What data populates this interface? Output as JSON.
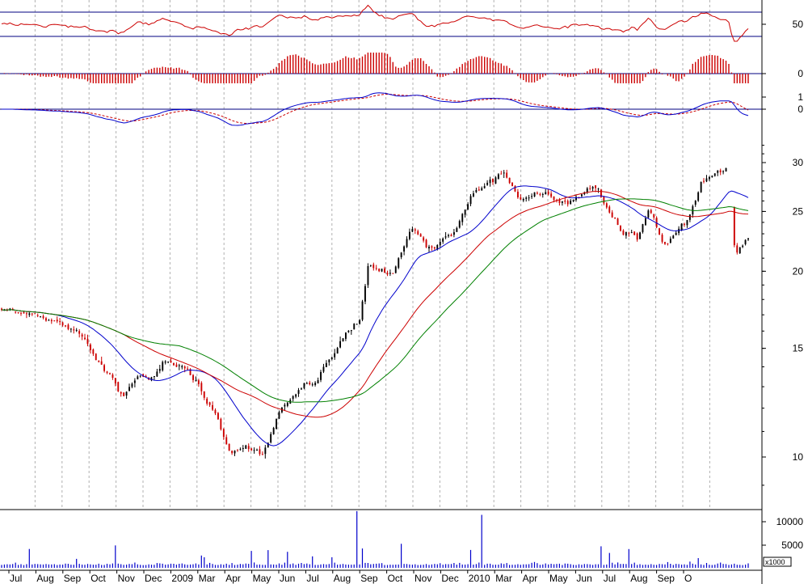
{
  "chart_data": {
    "type": "candlestick",
    "scale": "log",
    "grid": true,
    "colors": {
      "background": "#ffffff",
      "frame": "#000000",
      "grid": "#b0b0b0",
      "up_candle": "#000000",
      "down_candle": "#cc0000",
      "ma_short": "#0000cc",
      "ma_medium": "#cc0000",
      "ma_long": "#008000",
      "rsi_line": "#cc0000",
      "panel_ref_line": "#000080",
      "histogram": "#cc0000",
      "macd_line": "#0000cc",
      "macd_signal": "#cc0000",
      "volume": "#0000cc"
    },
    "x_axis": {
      "labels": [
        "Jul",
        "Aug",
        "Sep",
        "Oct",
        "Nov",
        "Dec",
        "2009",
        "Mar",
        "Apr",
        "May",
        "Jun",
        "Jul",
        "Aug",
        "Sep",
        "Oct",
        "Nov",
        "Dec",
        "2010",
        "Mar",
        "Apr",
        "May",
        "Jun",
        "Jul",
        "Aug",
        "Sep",
        "O"
      ]
    },
    "price_panel": {
      "y_ticks": [
        10,
        15,
        20,
        25,
        30
      ],
      "ylim": [
        8.5,
        33
      ],
      "anchors": [
        {
          "t": 0,
          "v": 17.3
        },
        {
          "t": 2.5,
          "v": 17.0
        },
        {
          "t": 4,
          "v": 16.4
        },
        {
          "t": 5.5,
          "v": 15.6
        },
        {
          "t": 7,
          "v": 13.8
        },
        {
          "t": 8.2,
          "v": 12.5
        },
        {
          "t": 9.2,
          "v": 13.6
        },
        {
          "t": 10.3,
          "v": 13.3
        },
        {
          "t": 11,
          "v": 14.2
        },
        {
          "t": 12.5,
          "v": 14.0
        },
        {
          "t": 13.5,
          "v": 12.8
        },
        {
          "t": 14.8,
          "v": 11.2
        },
        {
          "t": 15.5,
          "v": 10.1
        },
        {
          "t": 16.4,
          "v": 10.4
        },
        {
          "t": 17.6,
          "v": 10.1
        },
        {
          "t": 18.7,
          "v": 11.8
        },
        {
          "t": 19.8,
          "v": 12.8
        },
        {
          "t": 21.3,
          "v": 13.3
        },
        {
          "t": 23,
          "v": 15.5
        },
        {
          "t": 24.2,
          "v": 16.8
        },
        {
          "t": 24.8,
          "v": 20.8
        },
        {
          "t": 25.5,
          "v": 20.2
        },
        {
          "t": 26.5,
          "v": 20.0
        },
        {
          "t": 27.8,
          "v": 23.6
        },
        {
          "t": 28.8,
          "v": 21.5
        },
        {
          "t": 29.8,
          "v": 22.5
        },
        {
          "t": 30.8,
          "v": 23.5
        },
        {
          "t": 31.8,
          "v": 26.5
        },
        {
          "t": 33,
          "v": 28.3
        },
        {
          "t": 34,
          "v": 28.8
        },
        {
          "t": 35,
          "v": 26.0
        },
        {
          "t": 36,
          "v": 26.8
        },
        {
          "t": 37,
          "v": 26.6
        },
        {
          "t": 38.3,
          "v": 25.4
        },
        {
          "t": 39.5,
          "v": 26.8
        },
        {
          "t": 40.3,
          "v": 27.5
        },
        {
          "t": 41,
          "v": 25.0
        },
        {
          "t": 42,
          "v": 23.0
        },
        {
          "t": 43,
          "v": 22.4
        },
        {
          "t": 43.8,
          "v": 25.0
        },
        {
          "t": 44.8,
          "v": 22.2
        },
        {
          "t": 45.5,
          "v": 23.0
        },
        {
          "t": 46.5,
          "v": 24.2
        },
        {
          "t": 47.3,
          "v": 27.5
        },
        {
          "t": 48.3,
          "v": 29.0
        },
        {
          "t": 49.2,
          "v": 29.1
        },
        {
          "t": 49.6,
          "v": 21.5
        },
        {
          "t": 50.5,
          "v": 22.8
        }
      ],
      "moving_averages": [
        {
          "periods": 20,
          "color": "#0000cc"
        },
        {
          "periods": 45,
          "color": "#cc0000"
        },
        {
          "periods": 65,
          "color": "#008000"
        }
      ]
    },
    "rsi_panel": {
      "y_ticks": [
        50
      ],
      "ylim": [
        0,
        100
      ],
      "reference_lines": [
        70,
        30
      ]
    },
    "histogram_panel": {
      "y_ticks": [
        0
      ]
    },
    "macd_panel": {
      "y_ticks": [
        1,
        0
      ]
    },
    "volume_panel": {
      "y_ticks": [
        10000,
        5000
      ],
      "ylim": [
        0,
        13000
      ],
      "unit_label": "x1000",
      "baseline": 600
    }
  }
}
